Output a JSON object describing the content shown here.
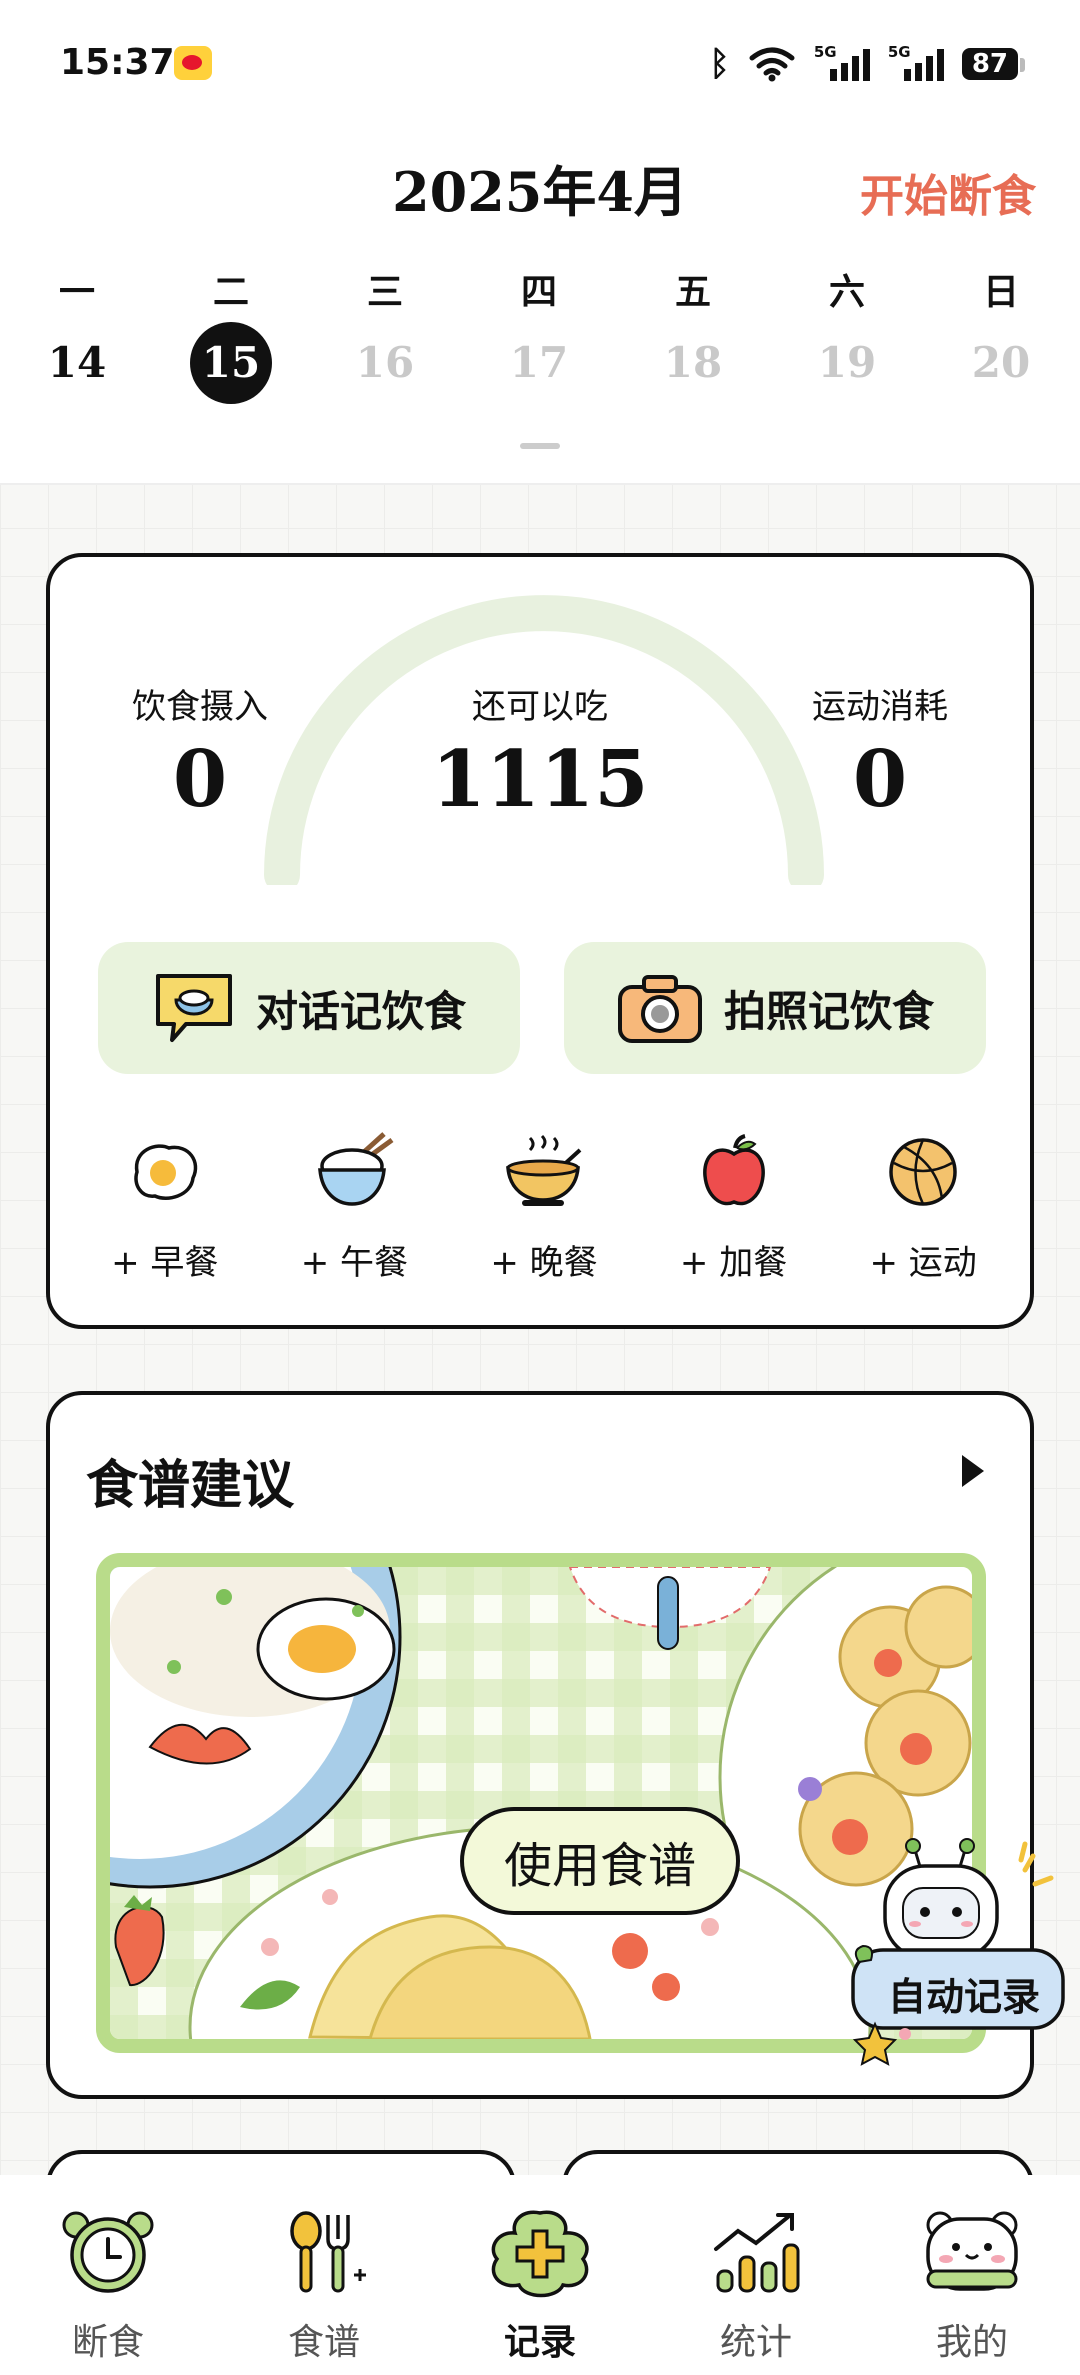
{
  "status_bar": {
    "time": "15:37",
    "battery": "87",
    "network": "5G"
  },
  "calendar": {
    "month_label": "2025年4月",
    "start_fasting": "开始断食",
    "weekdays": [
      "一",
      "二",
      "三",
      "四",
      "五",
      "六",
      "日"
    ],
    "dates": [
      "14",
      "15",
      "16",
      "17",
      "18",
      "19",
      "20"
    ],
    "selected_index": 1
  },
  "summary": {
    "intake_label": "饮食摄入",
    "intake_value": "0",
    "remaining_label": "还可以吃",
    "remaining_value": "1115",
    "burn_label": "运动消耗",
    "burn_value": "0",
    "chat_record_label": "对话记饮食",
    "photo_record_label": "拍照记饮食"
  },
  "meals": [
    {
      "label": "+ 早餐",
      "icon": "fried-egg-icon"
    },
    {
      "label": "+ 午餐",
      "icon": "rice-bowl-icon"
    },
    {
      "label": "+ 晚餐",
      "icon": "soup-bowl-icon"
    },
    {
      "label": "+ 加餐",
      "icon": "apple-icon"
    },
    {
      "label": "+ 运动",
      "icon": "basketball-icon"
    }
  ],
  "recipes": {
    "title": "食谱建议",
    "use_button": "使用食谱"
  },
  "auto_record": "自动记录",
  "tabs": [
    {
      "label": "断食",
      "icon": "alarm-clock-icon"
    },
    {
      "label": "食谱",
      "icon": "spoon-fork-icon"
    },
    {
      "label": "记录",
      "icon": "plus-flower-icon",
      "active": true
    },
    {
      "label": "统计",
      "icon": "bar-chart-icon"
    },
    {
      "label": "我的",
      "icon": "bear-face-icon"
    }
  ],
  "colors": {
    "accent_green": "#b9dc8a",
    "soft_green": "#e9f3dd",
    "fasting_orange": "#e76d55"
  }
}
